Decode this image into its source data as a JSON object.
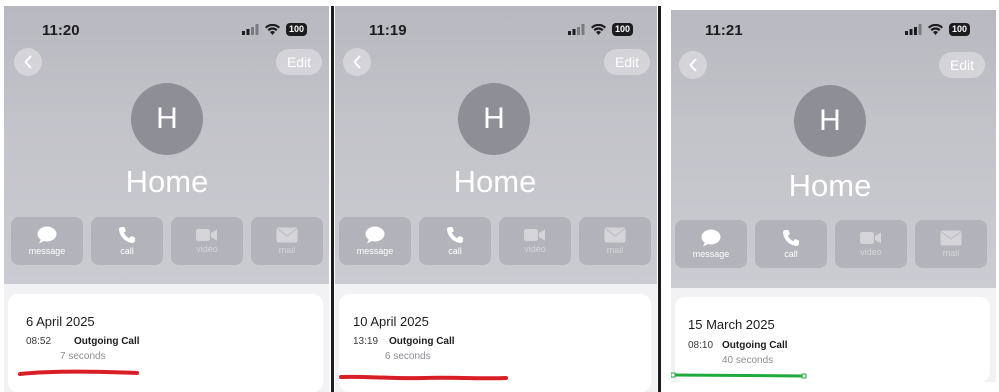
{
  "colors": {
    "header_gradient": "#c3c3ca",
    "avatar": "#8e8e96",
    "underline_red": "#d91f26",
    "underline_green": "#1faa3c"
  },
  "panels": [
    {
      "time": "11:20",
      "battery": "100",
      "edit_label": "Edit",
      "avatar_initial": "H",
      "contact_name": "Home",
      "actions": [
        {
          "label": "message",
          "icon": "message-icon",
          "enabled": true
        },
        {
          "label": "call",
          "icon": "phone-icon",
          "enabled": true
        },
        {
          "label": "video",
          "icon": "video-icon",
          "enabled": false
        },
        {
          "label": "mail",
          "icon": "mail-icon",
          "enabled": false
        }
      ],
      "call": {
        "date": "6 April 2025",
        "time": "08:52",
        "type": "Outgoing Call",
        "duration": "7 seconds"
      },
      "underline_color": "red"
    },
    {
      "time": "11:19",
      "battery": "100",
      "edit_label": "Edit",
      "avatar_initial": "H",
      "contact_name": "Home",
      "actions": [
        {
          "label": "message",
          "icon": "message-icon",
          "enabled": true
        },
        {
          "label": "call",
          "icon": "phone-icon",
          "enabled": true
        },
        {
          "label": "video",
          "icon": "video-icon",
          "enabled": false
        },
        {
          "label": "mail",
          "icon": "mail-icon",
          "enabled": false
        }
      ],
      "call": {
        "date": "10 April 2025",
        "time": "13:19",
        "type": "Outgoing Call",
        "duration": "6 seconds"
      },
      "underline_color": "red"
    },
    {
      "time": "11:21",
      "battery": "100",
      "edit_label": "Edit",
      "avatar_initial": "H",
      "contact_name": "Home",
      "actions": [
        {
          "label": "message",
          "icon": "message-icon",
          "enabled": true
        },
        {
          "label": "call",
          "icon": "phone-icon",
          "enabled": true
        },
        {
          "label": "video",
          "icon": "video-icon",
          "enabled": false
        },
        {
          "label": "mail",
          "icon": "mail-icon",
          "enabled": false
        }
      ],
      "call": {
        "date": "15 March 2025",
        "time": "08:10",
        "type": "Outgoing Call",
        "duration": "40 seconds"
      },
      "underline_color": "green"
    }
  ]
}
